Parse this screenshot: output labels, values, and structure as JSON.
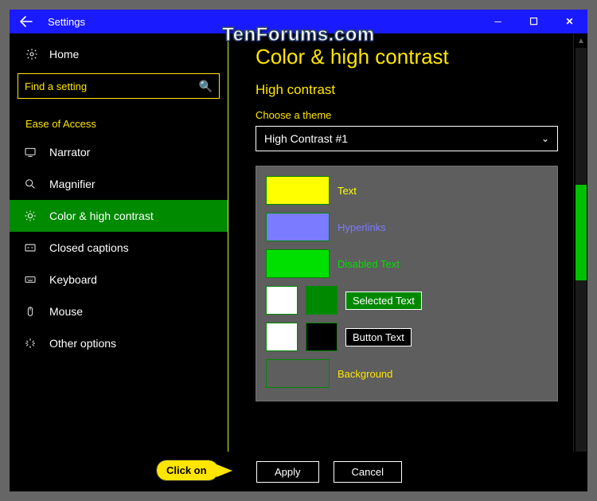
{
  "window": {
    "title": "Settings",
    "watermark": "TenForums.com"
  },
  "sidebar": {
    "home": "Home",
    "search_placeholder": "Find a setting",
    "section": "Ease of Access",
    "items": [
      {
        "label": "Narrator"
      },
      {
        "label": "Magnifier"
      },
      {
        "label": "Color & high contrast"
      },
      {
        "label": "Closed captions"
      },
      {
        "label": "Keyboard"
      },
      {
        "label": "Mouse"
      },
      {
        "label": "Other options"
      }
    ]
  },
  "main": {
    "heading": "Color & high contrast",
    "subheading": "High contrast",
    "theme_label": "Choose a theme",
    "theme_selected": "High Contrast #1",
    "swatches": {
      "text": {
        "label": "Text",
        "color": "#ffff00",
        "label_css": "color:#ffff00"
      },
      "hyperlinks": {
        "label": "Hyperlinks",
        "color": "#7b7bff",
        "label_css": "color:#7b7bff"
      },
      "disabled": {
        "label": "Disabled Text",
        "color": "#00e000",
        "label_css": "color:#00e000"
      },
      "selected": {
        "label": "Selected Text",
        "fg": "#ffffff",
        "bg": "#008800"
      },
      "button": {
        "label": "Button Text",
        "fg": "#ffffff",
        "bg": "#000000"
      },
      "background": {
        "label": "Background",
        "color": "#5e5e5e",
        "label_css": "color:#ffe600"
      }
    },
    "apply": "Apply",
    "cancel": "Cancel"
  },
  "callout": "Click on"
}
